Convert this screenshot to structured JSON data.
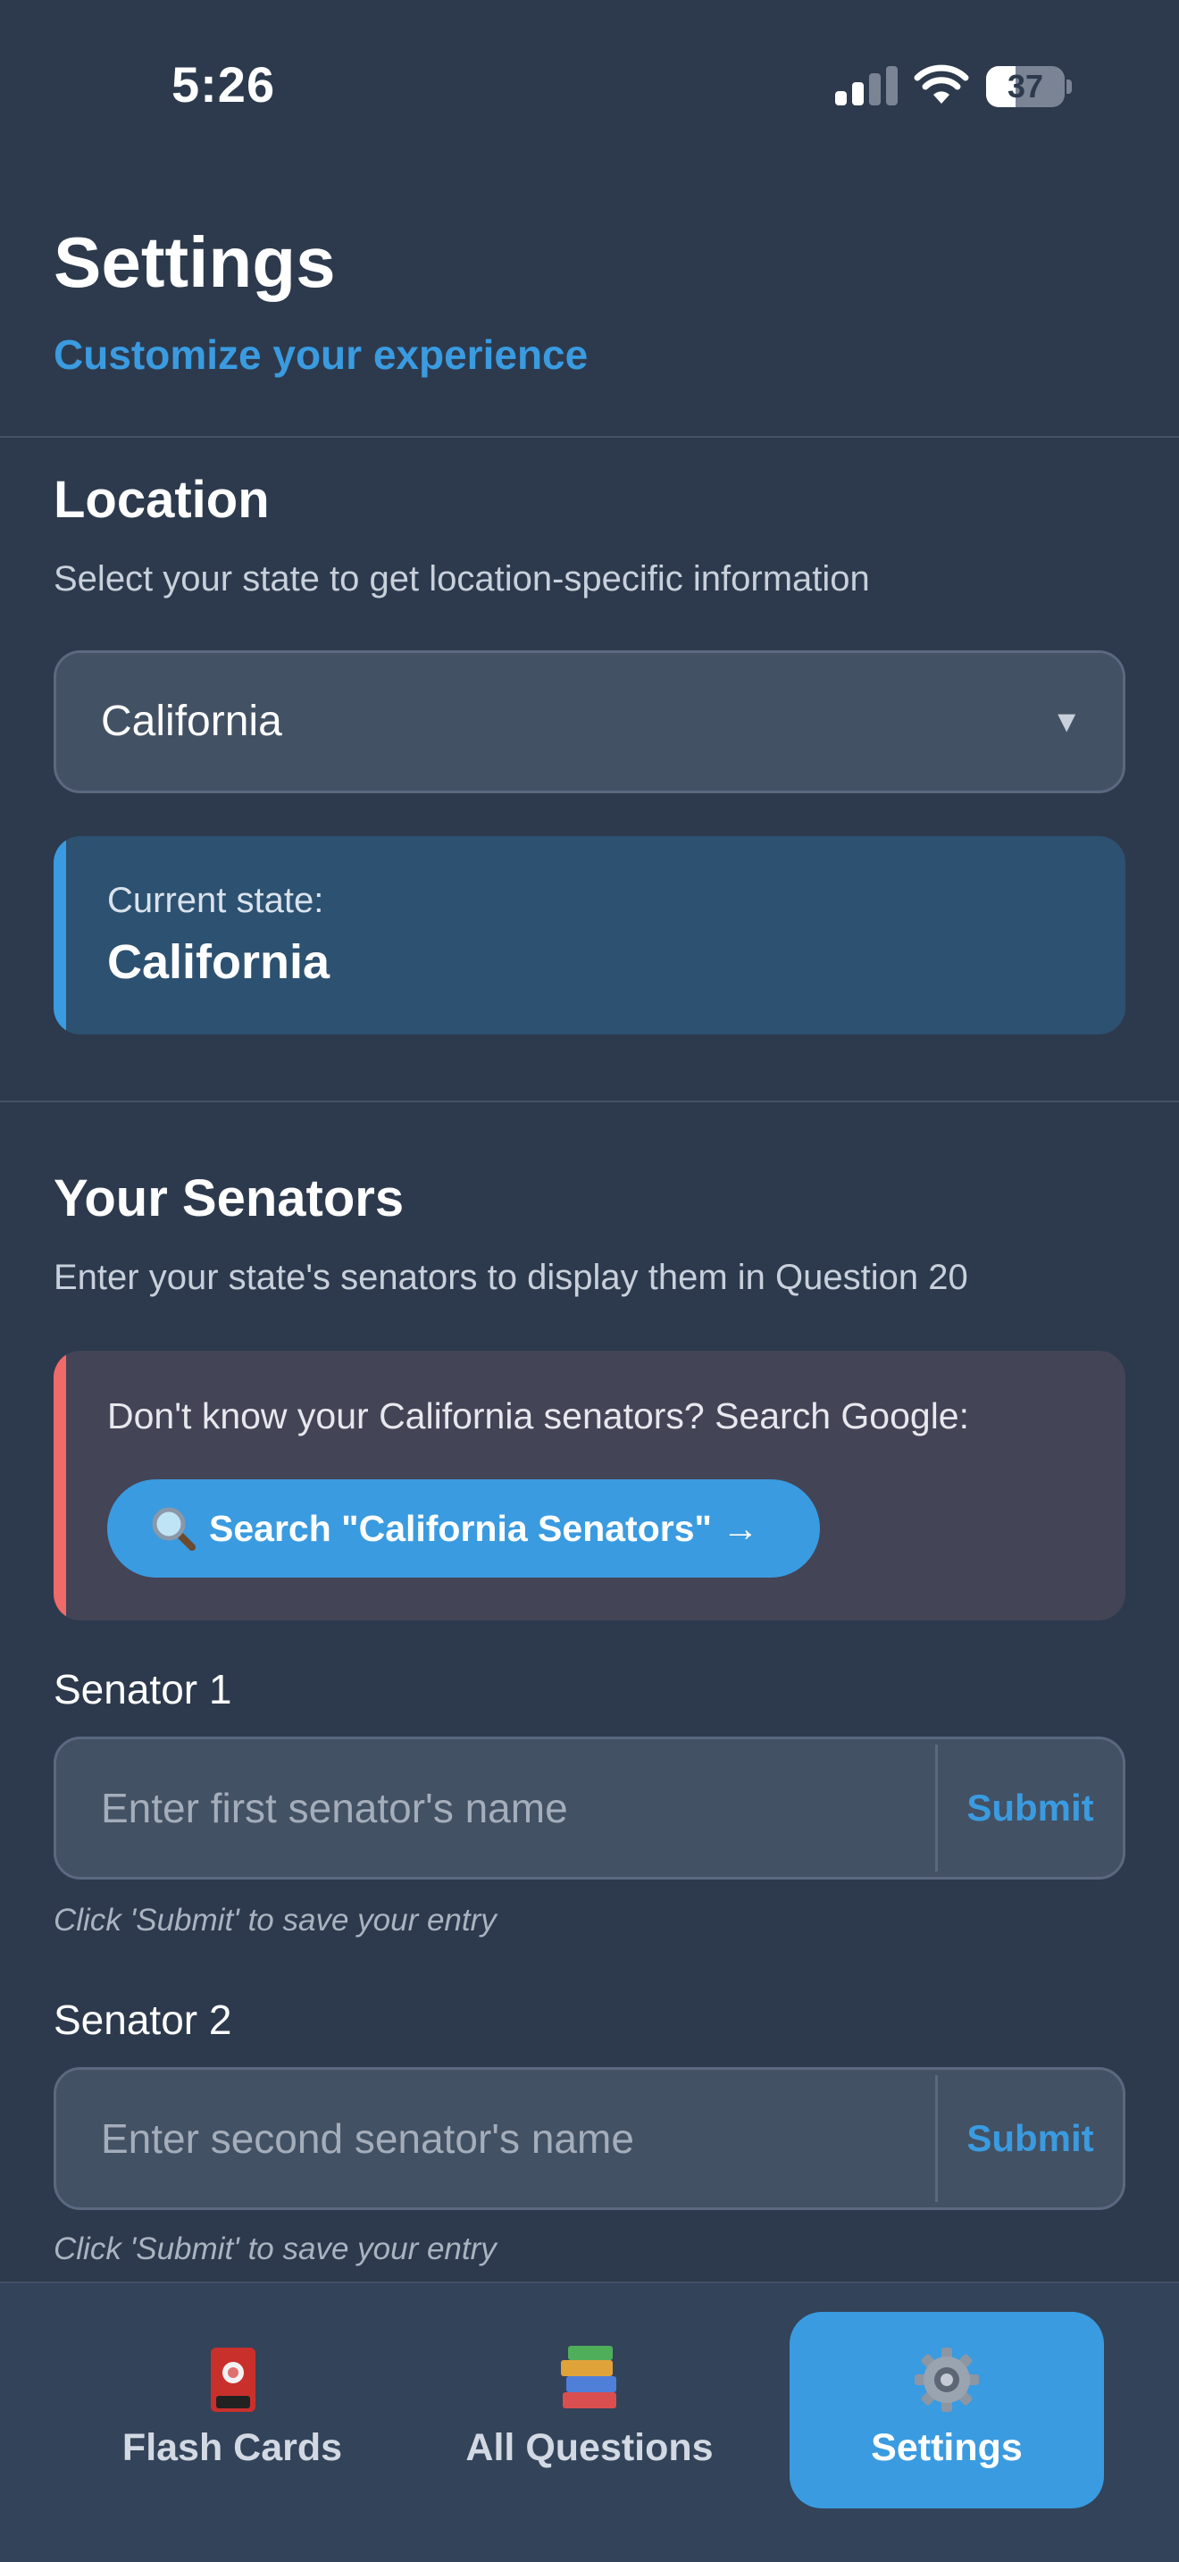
{
  "status_bar": {
    "time": "5:26",
    "battery_percent": "37",
    "battery_level": 0.37
  },
  "header": {
    "title": "Settings",
    "subtitle": "Customize your experience"
  },
  "location": {
    "title": "Location",
    "description": "Select your state to get location-specific information",
    "selected_state": "California",
    "dropdown_arrow": "▼",
    "current_state_label": "Current state:",
    "current_state_value": "California"
  },
  "senators": {
    "title": "Your Senators",
    "description": "Enter your state's senators to display them in Question 20",
    "help_text": "Don't know your California senators? Search Google:",
    "search_button_label": "Search \"California Senators\" →",
    "senator1": {
      "label": "Senator 1",
      "value": "",
      "placeholder": "Enter first senator's name",
      "submit_label": "Submit",
      "hint": "Click 'Submit' to save your entry"
    },
    "senator2": {
      "label": "Senator 2",
      "value": "",
      "placeholder": "Enter second senator's name",
      "submit_label": "Submit",
      "hint": "Click 'Submit' to save your entry"
    }
  },
  "tabs": [
    {
      "label": "Flash Cards",
      "icon": "flash-card-icon",
      "active": false
    },
    {
      "label": "All Questions",
      "icon": "books-icon",
      "active": false
    },
    {
      "label": "Settings",
      "icon": "gear-icon",
      "active": true
    }
  ],
  "colors": {
    "background": "#2d3a4d",
    "accent": "#3a9be0",
    "warning_accent": "#f06a6a",
    "tab_bar": "#33435a"
  }
}
